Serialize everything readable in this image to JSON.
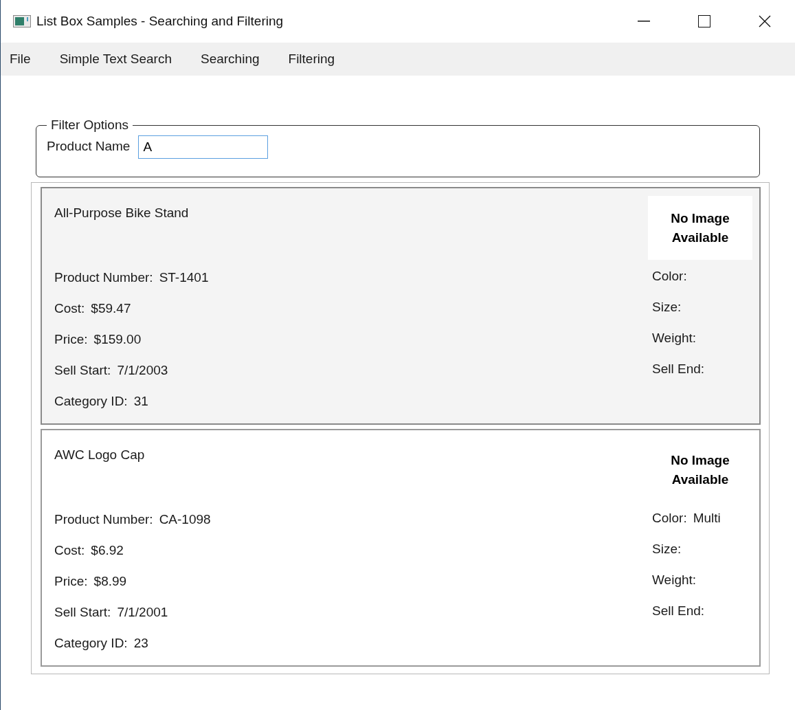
{
  "window": {
    "title": "List Box Samples - Searching and Filtering"
  },
  "menu": [
    "File",
    "Simple Text Search",
    "Searching",
    "Filtering"
  ],
  "filter": {
    "title": "Filter Options",
    "label": "Product Name",
    "value": "A"
  },
  "products": [
    {
      "name": "All-Purpose Bike Stand",
      "selected": true,
      "image_text": "No Image Available",
      "left": [
        {
          "label": "Product Number:",
          "value": "ST-1401"
        },
        {
          "label": "Cost:",
          "value": "$59.47"
        },
        {
          "label": "Price:",
          "value": "$159.00"
        },
        {
          "label": "Sell Start:",
          "value": "7/1/2003"
        },
        {
          "label": "Category ID:",
          "value": "31"
        }
      ],
      "right": [
        {
          "label": "Color:"
        },
        {
          "label": "Size:"
        },
        {
          "label": "Weight:"
        },
        {
          "label": "Sell End:"
        }
      ]
    },
    {
      "name": "AWC Logo Cap",
      "selected": false,
      "image_text": "No Image Available",
      "left": [
        {
          "label": "Product Number:",
          "value": "CA-1098"
        },
        {
          "label": "Cost:",
          "value": "$6.92"
        },
        {
          "label": "Price:",
          "value": "$8.99"
        },
        {
          "label": "Sell Start:",
          "value": "7/1/2001"
        },
        {
          "label": "Category ID:",
          "value": "23"
        }
      ],
      "right": [
        {
          "label": "Color:",
          "value": "Multi"
        },
        {
          "label": "Size:"
        },
        {
          "label": "Weight:"
        },
        {
          "label": "Sell End:"
        }
      ]
    }
  ]
}
